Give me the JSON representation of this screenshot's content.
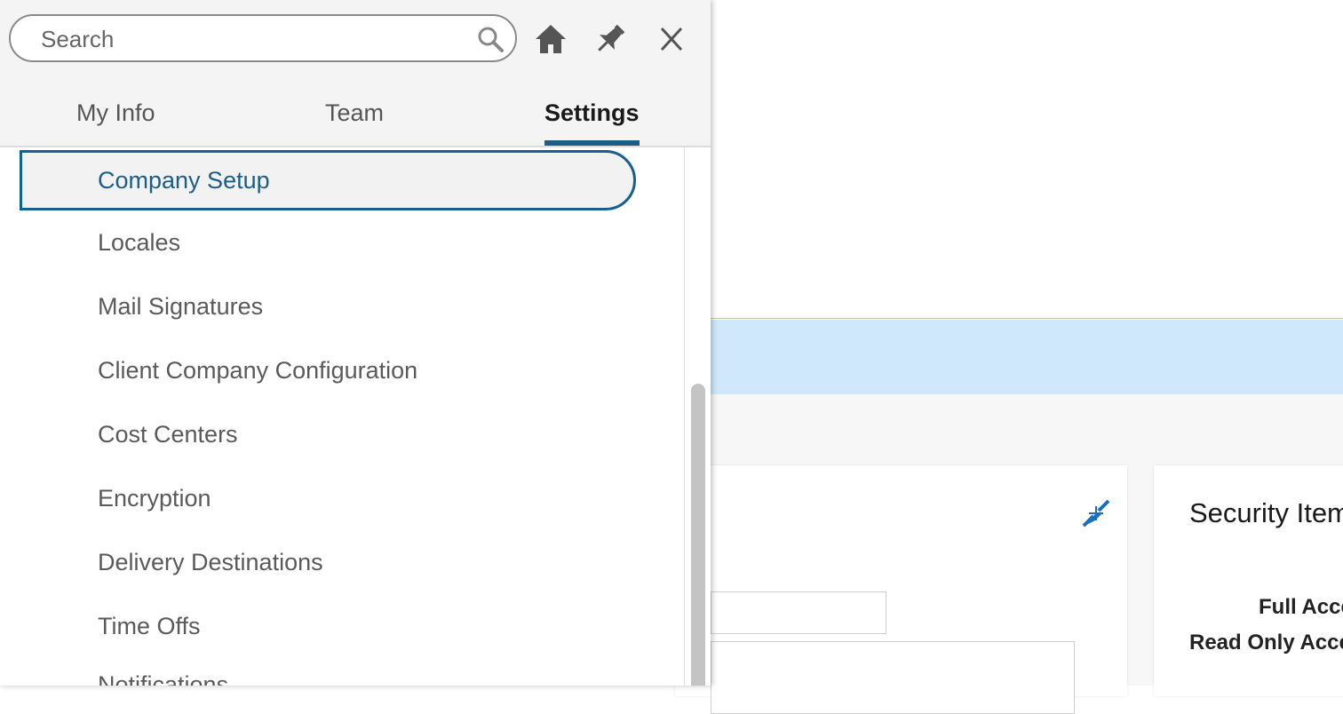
{
  "panel": {
    "search": {
      "placeholder": "Search"
    },
    "icons": [
      "search-icon",
      "home-icon",
      "pin-icon",
      "close-icon"
    ],
    "tabs": [
      {
        "label": "My Info",
        "active": false
      },
      {
        "label": "Team",
        "active": false
      },
      {
        "label": "Settings",
        "active": true
      }
    ],
    "menu": {
      "items": [
        {
          "label": "Company Setup",
          "active": true
        },
        {
          "label": "Locales"
        },
        {
          "label": "Mail Signatures"
        },
        {
          "label": "Client Company Configuration"
        },
        {
          "label": "Cost Centers"
        },
        {
          "label": "Encryption"
        },
        {
          "label": "Delivery Destinations"
        },
        {
          "label": "Time Offs"
        },
        {
          "label": "Notifications"
        }
      ]
    }
  },
  "background": {
    "security_card": {
      "title": "Security Items",
      "rows": [
        "Full Access",
        "Read Only Access"
      ]
    },
    "left_card": {
      "collapse_icon": "collapse-arrows-icon"
    }
  },
  "colors": {
    "accent": "#1b5e8a",
    "banner": "#cfe8fb",
    "icon_blue": "#1a6fc0",
    "panel_header": "#f4f4f4"
  }
}
